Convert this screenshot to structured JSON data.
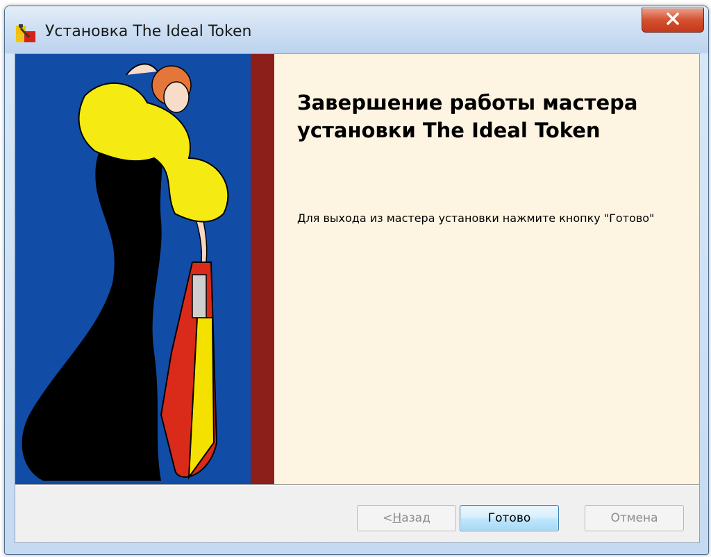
{
  "window": {
    "title": "Установка The Ideal Token",
    "app_icon": "installer-icon",
    "close_icon": "close-icon"
  },
  "wizard": {
    "heading": "Завершение работы мастера установки The Ideal Token",
    "message": "Для выхода из мастера установки нажмите кнопку \"Готово\"",
    "hero_image": "woman-in-black-dress-illustration"
  },
  "buttons": {
    "back_prefix": "< ",
    "back_accel": "Н",
    "back_rest": "азад",
    "finish": "Готово",
    "cancel": "Отмена"
  },
  "colors": {
    "hero_background": "#114da7",
    "hero_stripe": "#8c1f1a",
    "content_background": "#fdf4e2"
  }
}
